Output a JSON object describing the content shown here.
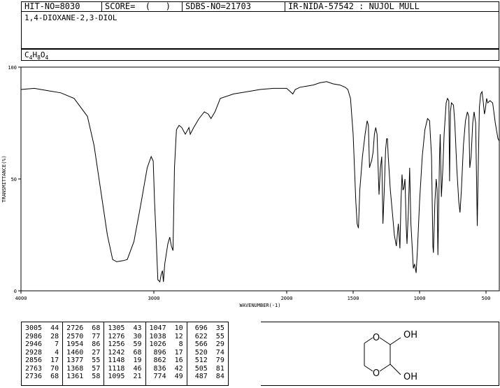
{
  "header": {
    "hit_no": "HIT-NO=8030",
    "score": "SCORE=  (   )",
    "sdbs_no": "SDBS-NO=21703",
    "ir_info": "IR-NIDA-57542 : NUJOL MULL"
  },
  "compound": {
    "name": "1,4-DIOXANE-2,3-DIOL",
    "formula_parts": [
      {
        "t": "C",
        "sub": false
      },
      {
        "t": "4",
        "sub": true
      },
      {
        "t": "H",
        "sub": false
      },
      {
        "t": "8",
        "sub": true
      },
      {
        "t": "O",
        "sub": false
      },
      {
        "t": "4",
        "sub": true
      }
    ]
  },
  "chart_data": {
    "type": "line",
    "xlabel": "WAVENUMBER(-1)",
    "ylabel": "TRANSMITTANCE(%)",
    "xlim": [
      4000,
      400
    ],
    "ylim": [
      0,
      100
    ],
    "x_ticks": [
      4000,
      3000,
      2000,
      1500,
      1000,
      500
    ],
    "y_ticks": [
      0,
      50,
      100
    ],
    "series": [
      {
        "points": [
          [
            4000,
            90
          ],
          [
            3900,
            90.5
          ],
          [
            3800,
            89.5
          ],
          [
            3700,
            88.5
          ],
          [
            3600,
            86
          ],
          [
            3500,
            78
          ],
          [
            3450,
            65
          ],
          [
            3400,
            45
          ],
          [
            3350,
            25
          ],
          [
            3310,
            14
          ],
          [
            3280,
            13
          ],
          [
            3230,
            13.5
          ],
          [
            3200,
            14
          ],
          [
            3150,
            22
          ],
          [
            3100,
            38
          ],
          [
            3050,
            55
          ],
          [
            3020,
            60
          ],
          [
            3005,
            58
          ],
          [
            2995,
            40
          ],
          [
            2986,
            28
          ],
          [
            2970,
            5
          ],
          [
            2955,
            4
          ],
          [
            2946,
            7
          ],
          [
            2935,
            9
          ],
          [
            2928,
            4
          ],
          [
            2918,
            12
          ],
          [
            2895,
            21
          ],
          [
            2880,
            24
          ],
          [
            2868,
            20
          ],
          [
            2856,
            18
          ],
          [
            2845,
            55
          ],
          [
            2830,
            72
          ],
          [
            2810,
            74
          ],
          [
            2790,
            73
          ],
          [
            2763,
            70
          ],
          [
            2736,
            73
          ],
          [
            2726,
            70
          ],
          [
            2700,
            73
          ],
          [
            2660,
            77
          ],
          [
            2620,
            80
          ],
          [
            2590,
            79
          ],
          [
            2570,
            77
          ],
          [
            2540,
            80
          ],
          [
            2500,
            86
          ],
          [
            2400,
            88
          ],
          [
            2300,
            89
          ],
          [
            2200,
            90
          ],
          [
            2100,
            90.5
          ],
          [
            2000,
            90.5
          ],
          [
            1954,
            88
          ],
          [
            1935,
            90
          ],
          [
            1900,
            91
          ],
          [
            1850,
            91.5
          ],
          [
            1800,
            92
          ],
          [
            1750,
            93
          ],
          [
            1700,
            93.5
          ],
          [
            1650,
            92.5
          ],
          [
            1600,
            92
          ],
          [
            1560,
            91
          ],
          [
            1540,
            90
          ],
          [
            1520,
            86
          ],
          [
            1500,
            70
          ],
          [
            1480,
            40
          ],
          [
            1470,
            30
          ],
          [
            1460,
            28
          ],
          [
            1450,
            45
          ],
          [
            1430,
            60
          ],
          [
            1410,
            70
          ],
          [
            1395,
            76
          ],
          [
            1385,
            74
          ],
          [
            1377,
            55
          ],
          [
            1368,
            57
          ],
          [
            1361,
            58
          ],
          [
            1350,
            62
          ],
          [
            1340,
            70
          ],
          [
            1330,
            73
          ],
          [
            1320,
            70
          ],
          [
            1305,
            43
          ],
          [
            1295,
            55
          ],
          [
            1285,
            60
          ],
          [
            1276,
            30
          ],
          [
            1266,
            45
          ],
          [
            1256,
            63
          ],
          [
            1248,
            68
          ],
          [
            1242,
            68
          ],
          [
            1236,
            60
          ],
          [
            1220,
            45
          ],
          [
            1205,
            35
          ],
          [
            1190,
            25
          ],
          [
            1175,
            20
          ],
          [
            1160,
            30
          ],
          [
            1148,
            19
          ],
          [
            1140,
            40
          ],
          [
            1132,
            52
          ],
          [
            1125,
            45
          ],
          [
            1118,
            46
          ],
          [
            1110,
            50
          ],
          [
            1100,
            28
          ],
          [
            1095,
            21
          ],
          [
            1085,
            35
          ],
          [
            1075,
            55
          ],
          [
            1065,
            30
          ],
          [
            1047,
            10
          ],
          [
            1038,
            12
          ],
          [
            1026,
            8
          ],
          [
            1015,
            20
          ],
          [
            1000,
            40
          ],
          [
            980,
            60
          ],
          [
            960,
            72
          ],
          [
            940,
            77
          ],
          [
            925,
            76
          ],
          [
            910,
            60
          ],
          [
            900,
            20
          ],
          [
            896,
            17
          ],
          [
            885,
            40
          ],
          [
            875,
            50
          ],
          [
            868,
            45
          ],
          [
            862,
            16
          ],
          [
            855,
            40
          ],
          [
            850,
            60
          ],
          [
            845,
            70
          ],
          [
            836,
            42
          ],
          [
            825,
            55
          ],
          [
            815,
            70
          ],
          [
            800,
            84
          ],
          [
            790,
            86
          ],
          [
            780,
            85
          ],
          [
            774,
            49
          ],
          [
            768,
            80
          ],
          [
            760,
            84
          ],
          [
            745,
            83
          ],
          [
            735,
            75
          ],
          [
            720,
            55
          ],
          [
            705,
            40
          ],
          [
            696,
            35
          ],
          [
            685,
            45
          ],
          [
            670,
            65
          ],
          [
            655,
            76
          ],
          [
            640,
            80
          ],
          [
            630,
            78
          ],
          [
            622,
            55
          ],
          [
            612,
            60
          ],
          [
            600,
            75
          ],
          [
            590,
            80
          ],
          [
            578,
            75
          ],
          [
            566,
            29
          ],
          [
            560,
            50
          ],
          [
            550,
            82
          ],
          [
            540,
            88
          ],
          [
            530,
            89
          ],
          [
            520,
            84
          ],
          [
            512,
            79
          ],
          [
            505,
            81
          ],
          [
            495,
            86
          ],
          [
            487,
            84
          ],
          [
            470,
            85
          ],
          [
            450,
            84
          ],
          [
            430,
            75
          ],
          [
            410,
            68
          ],
          [
            400,
            67
          ]
        ]
      }
    ]
  },
  "peak_columns": [
    [
      "3005  44",
      "2986  28",
      "2946   7",
      "2928   4",
      "2856  17",
      "2763  70",
      "2736  68"
    ],
    [
      "2726  68",
      "2570  77",
      "1954  86",
      "1460  27",
      "1377  55",
      "1368  57",
      "1361  58"
    ],
    [
      "1305  43",
      "1276  30",
      "1256  59",
      "1242  68",
      "1148  19",
      "1118  46",
      "1095  21"
    ],
    [
      "1047  10",
      "1038  12",
      "1026   8",
      " 896  17",
      " 862  16",
      " 836  42",
      " 774  49"
    ],
    [
      " 696  35",
      " 622  55",
      " 566  29",
      " 520  74",
      " 512  79",
      " 505  81",
      " 487  84"
    ]
  ],
  "structure": {
    "oh_top": "OH",
    "oh_bottom": "OH",
    "o_top": "O",
    "o_bottom": "O"
  }
}
